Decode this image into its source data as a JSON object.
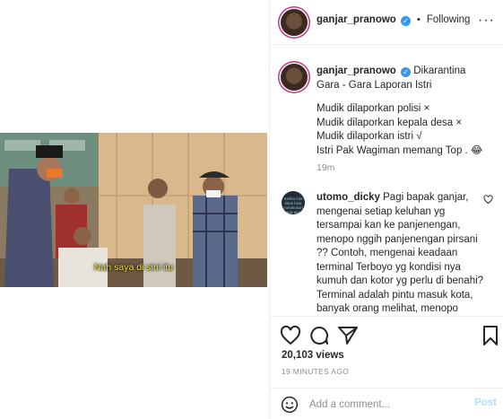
{
  "video": {
    "subtitle": "Nah saya di sini itu"
  },
  "header": {
    "username": "ganjar_pranowo",
    "separator": "•",
    "follow_status": "Following",
    "verified_icon": "verified-check-icon",
    "more_icon": "ellipsis-icon"
  },
  "post": {
    "username": "ganjar_pranowo",
    "title": "Dikarantina Gara - Gara Laporan Istri",
    "lines": [
      "Mudik dilaporkan polisi ×",
      "Mudik dilaporkan kepala desa ×",
      "Mudik dilaporkan istri √",
      "Istri Pak Wagiman memang Top . 😂"
    ],
    "time": "19m"
  },
  "comment": {
    "username": "utomo_dicky",
    "text": "Pagi bapak ganjar, mengenai setiap keluhan yg tersampai kan ke panjenengan, menopo nggih panjenengan pirsani ?? Contoh, mengenai keadaan terminal Terboyo yg kondisi nya kumuh dan kotor yg perlu di benahi? Terminal adalah pintu masuk kota, banyak orang melihat, menopo mboten risih",
    "avatar_text": "Ketika kita tidak bisa melakukan apa-apa"
  },
  "actions": {
    "views": "20,103 views",
    "time_ago": "19 MINUTES AGO"
  },
  "add_comment": {
    "placeholder": "Add a comment...",
    "post_label": "Post"
  },
  "colors": {
    "link_blue": "#3897f0",
    "post_disabled": "#b2dffc",
    "subtitle_yellow": "#f5e14a",
    "secondary_text": "#8e8e8e"
  }
}
